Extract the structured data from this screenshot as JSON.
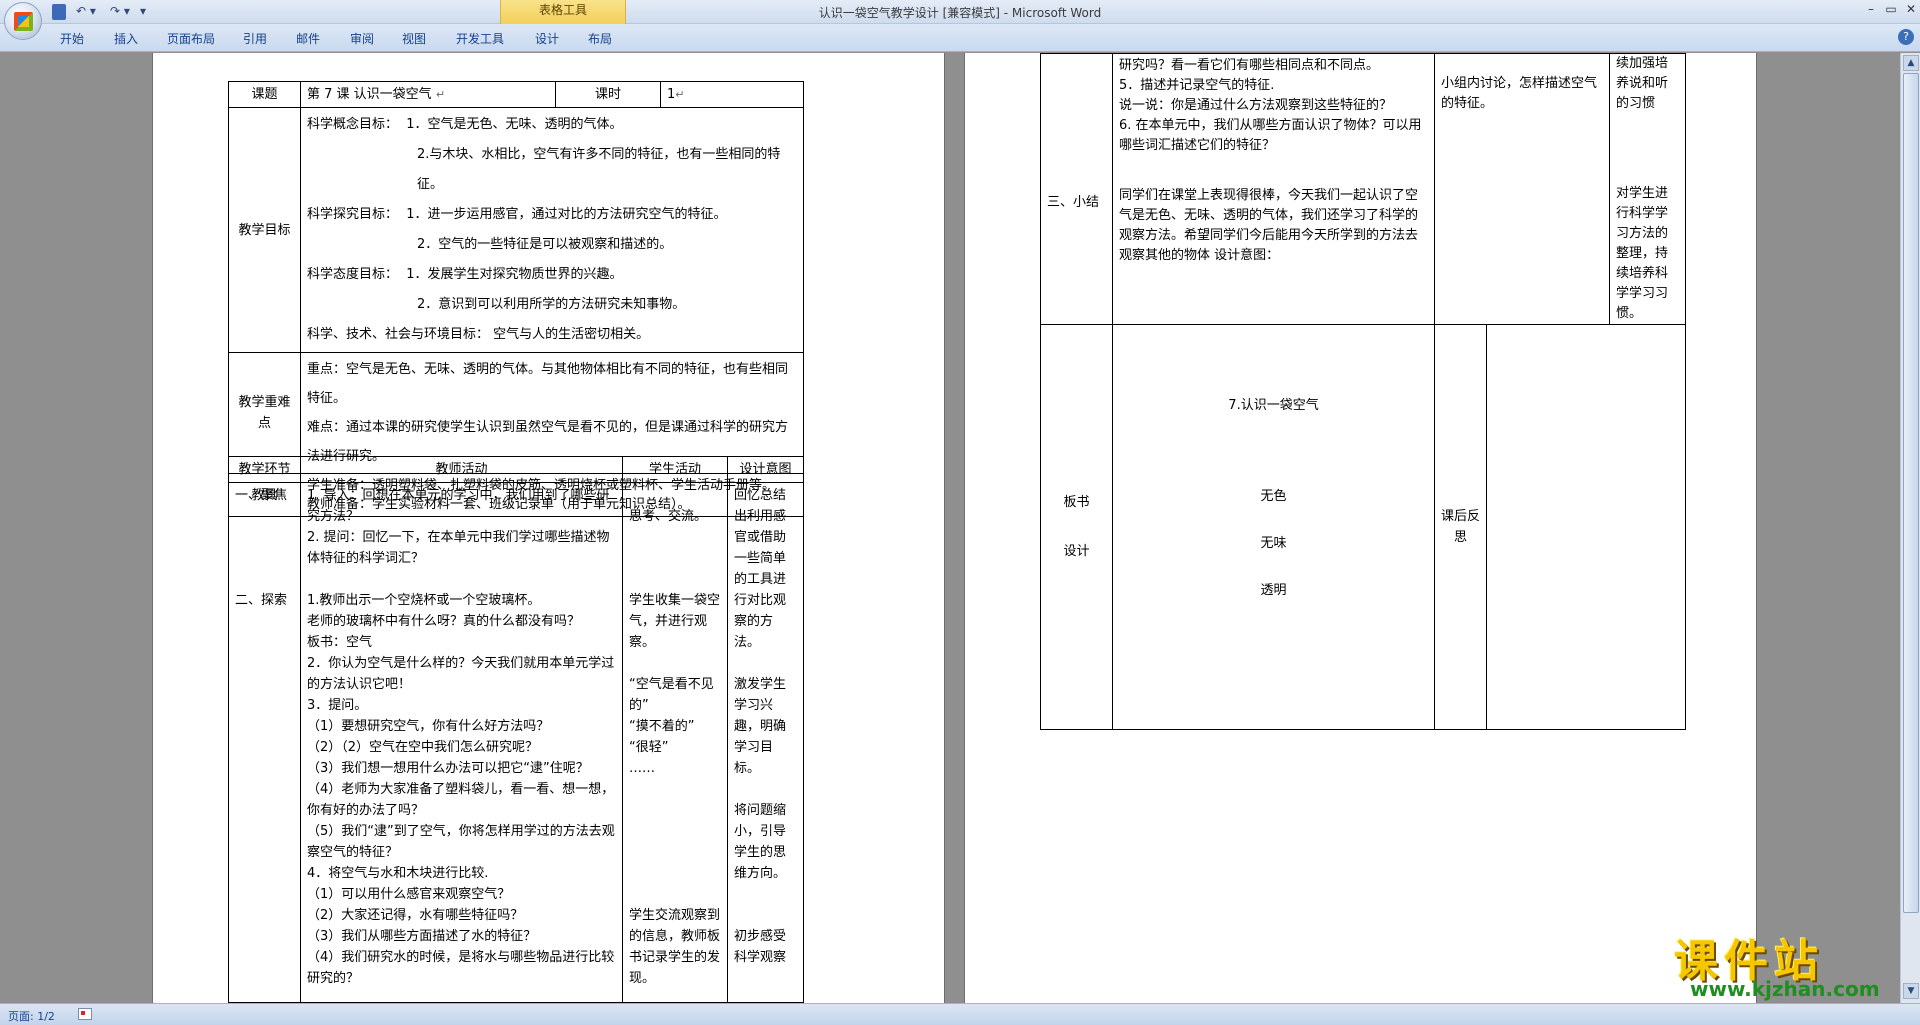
{
  "window": {
    "title": "认识一袋空气教学设计 [兼容模式] - Microsoft Word",
    "context_tab_group": "表格工具",
    "controls": {
      "minimize": "–",
      "maximize": "▭",
      "close": "✕"
    },
    "qat": {
      "undo": "↶ ▾",
      "redo": "↷ ▾",
      "more": "▾"
    }
  },
  "ribbon": {
    "tabs": [
      "开始",
      "插入",
      "页面布局",
      "引用",
      "邮件",
      "审阅",
      "视图",
      "开发工具",
      "设计",
      "布局"
    ],
    "help": "?"
  },
  "page1": {
    "row_title": {
      "label": "课题",
      "title": "第 7 课   认识一袋空气",
      "hours_label": "课时",
      "hours": "1"
    },
    "goals": {
      "label": "教学目标",
      "concept_label": "科学概念目标：",
      "concept_1": "1．空气是无色、无味、透明的气体。",
      "concept_2": "2.与木块、水相比，空气有许多不同的特征，也有一些相同的特征。",
      "explore_label": "科学探究目标：",
      "explore_1": "1．进一步运用感官，通过对比的方法研究空气的特征。",
      "explore_2": "2．空气的一些特征是可以被观察和描述的。",
      "attitude_label": "科学态度目标：",
      "attitude_1": "1．发展学生对探究物质世界的兴趣。",
      "attitude_2": "2．意识到可以利用所学的方法研究未知事物。",
      "sts": "科学、技术、社会与环境目标：  空气与人的生活密切相关。"
    },
    "key_points": {
      "label": "教学重难点",
      "key": "重点：空气是无色、无味、透明的气体。与其他物体相比有不同的特征，也有些相同特征。",
      "difficult": "难点：通过本课的研究使学生认识到虽然空气是看不见的，但是课通过科学的研究方法进行研究。"
    },
    "materials": {
      "label": "教具",
      "student": "学生准备：透明塑料袋、扎塑料袋的皮筋、透明烧杯或塑料杯、学生活动手册等。",
      "teacher": "教师准备：学生实验材料一套、班级记录单（用于单元知识总结）。"
    },
    "headers": {
      "section": "教学环节",
      "teacher": "教师活动",
      "student": "学生活动",
      "design": "设计意图"
    },
    "section_1": "一、聚焦",
    "section_2": "二、探索",
    "teacher_lines": [
      "1. 导入：回想在本单元的学习中，我们用到了哪些研究方法？",
      "2. 提问：回忆一下，在本单元中我们学过哪些描述物体特征的科学词汇？",
      "1.教师出示一个空烧杯或一个空玻璃杯。",
      "老师的玻璃杯中有什么呀？真的什么都没有吗？",
      "板书：空气",
      "2．你认为空气是什么样的？今天我们就用本单元学过的方法认识它吧！",
      "3．提问。",
      "（1）要想研究空气，你有什么好方法吗？",
      "（2）（2）空气在空中我们怎么研究呢？",
      "（3）我们想一想用什么办法可以把它“逮”住呢？",
      "（4）老师为大家准备了塑料袋儿，看一看、想一想，你有好的办法了吗？",
      "（5）我们“逮”到了空气，你将怎样用学过的方法去观察空气的特征？",
      "4．将空气与水和木块进行比较.",
      "（1）可以用什么感官来观察空气？",
      "（2）大家还记得，水有哪些特征吗？",
      "（3）我们从哪些方面描述了水的特征？",
      "（4）我们研究水的时候，是将水与哪些物品进行比较研究的？"
    ],
    "student_lines": [
      "思考、交流。",
      "学生收集一袋空气，并进行观察。",
      "“空气是看不见的”",
      "“摸不着的”",
      "“很轻”",
      "……",
      "学生交流观察到的信息，教师板书记录学生的发现。"
    ],
    "design_lines": [
      "回忆总结出利用感官或借助一些简单的工具进行对比观察的方法。",
      "激发学生学习兴趣，明确学习目标。",
      "将问题缩小，引导学生的思维方向。",
      "初步感受科学观察"
    ]
  },
  "page2": {
    "summary_label": "三、小结",
    "top_lines": [
      "研究吗？看一看它们有哪些相同点和不同点。",
      "5．描述并记录空气的特征.",
      "说一说：你是通过什么方法观察到这些特征的？",
      "6. 在本单元中，我们从哪些方面认识了物体？可以用哪些词汇描述它们的特征？"
    ],
    "summary_text": "同学们在课堂上表现得很棒，今天我们一起认识了空气是无色、无味、透明的气体，我们还学习了科学的观察方法。希望同学们今后能用今天所学到的方法去观察其他的物体  设计意图：",
    "student_text": "小组内讨论，怎样描述空气的特征。",
    "design_top": "续加强培养说和听的习惯",
    "design_bottom": "对学生进行科学学习方法的整理，持续培养科学学习习惯。",
    "board_label_1": "板书",
    "board_label_2": "设计",
    "board_title": "7.认识一袋空气",
    "board_items": [
      "无色",
      "无味",
      "透明"
    ],
    "reflection_label": "课后反思"
  },
  "status": {
    "page": "页面: 1/2"
  },
  "watermark": {
    "cn": "课件站",
    "url": "www.kjzhan.com"
  },
  "mark": "↵"
}
